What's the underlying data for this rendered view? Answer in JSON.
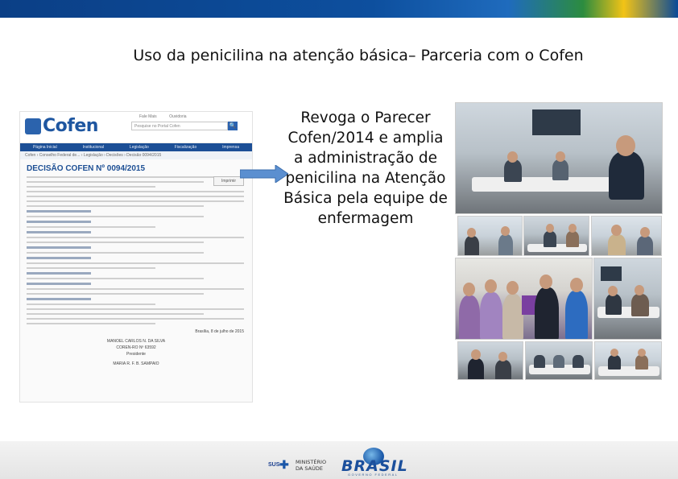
{
  "slide": {
    "title": "Uso da penicilina na atenção básica– Parceria com o Cofen",
    "callout_lines": [
      "Revoga o Parecer",
      "Cofen/2014 e amplia",
      "a administração de",
      "penicilina na Atenção",
      "Básica pela equipe de",
      "enfermagem"
    ]
  },
  "document": {
    "logo": "Cofen",
    "top_links": [
      "Fale Mais",
      "Ouvidoria"
    ],
    "search_placeholder": "Pesquise no Portal Cofen",
    "search_button": "🔍",
    "nav": [
      "Página Inicial",
      "Institucional",
      "Legislação",
      "Fiscalização",
      "Imprensa"
    ],
    "breadcrumb": "Cofen › Conselho Federal de... › Legislação › Decisões › Decisão 0094/2015",
    "heading": "DECISÃO COFEN Nº 0094/2015",
    "badge": "Imprimir",
    "signature_city": "Brasília, 8 de julho de 2015",
    "signature_1": "MANOEL CARLOS N. DA SILVA",
    "signature_1_role": "COREN-RO Nº 63592",
    "signature_1_title": "Presidente",
    "signature_2": "MARIA R. F. B. SAMPAIO"
  },
  "footer": {
    "sus": "SUS",
    "ministry_line1": "MINISTÉRIO",
    "ministry_line2": "DA SAÚDE",
    "brasil": "BRASIL",
    "brasil_sub": "GOVERNO FEDERAL"
  },
  "colors": {
    "cofen_blue": "#1e56a0",
    "arrow_fill": "#5b8fd0",
    "top_bar": "#0b3f86"
  },
  "icons": {
    "arrow": "right-arrow-icon",
    "search": "search-icon"
  }
}
